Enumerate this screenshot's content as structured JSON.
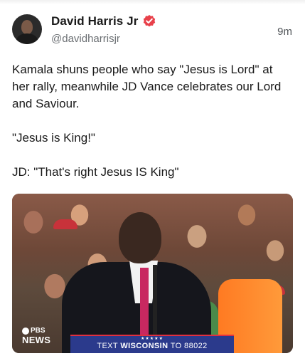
{
  "post": {
    "author": {
      "display_name": "David Harris Jr",
      "handle": "@davidharrisjr",
      "verified_badge_color": "#e8404a"
    },
    "timestamp": "9m",
    "body": [
      "Kamala shuns people who say \"Jesus is Lord\" at her rally, meanwhile JD Vance celebrates our Lord and Saviour.",
      "\"Jesus is King!\"",
      "JD: \"That's right Jesus IS King\""
    ],
    "media": {
      "watermark_top": "PBS",
      "watermark_bottom": "NEWS",
      "banner_stars": "★★★★★",
      "banner_prefix": "TEXT ",
      "banner_keyword": "WISCONSIN",
      "banner_suffix": " TO 88022"
    }
  },
  "colors": {
    "text_primary": "#1a1a1a",
    "text_secondary": "#6b6f73",
    "banner_bg": "#2b3a8c"
  }
}
